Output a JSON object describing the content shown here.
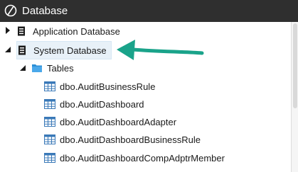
{
  "window": {
    "title": "Database",
    "logo_icon": "onestream-logo-icon"
  },
  "tree": {
    "databases": [
      {
        "label": "Application Database",
        "expanded": false,
        "icon": "database-icon"
      },
      {
        "label": "System Database",
        "expanded": true,
        "selected": true,
        "icon": "database-icon"
      }
    ],
    "folder": {
      "label": "Tables",
      "icon": "folder-icon",
      "expanded": true
    },
    "tables": [
      "dbo.AuditBusinessRule",
      "dbo.AuditDashboard",
      "dbo.AuditDashboardAdapter",
      "dbo.AuditDashboardBusinessRule",
      "dbo.AuditDashboardCompAdptrMember"
    ]
  },
  "annotation": {
    "icon": "pointer-arrow-icon",
    "color": "#1aa38a"
  },
  "colors": {
    "titlebar": "#2f2f2f",
    "selection": "#e8f1f8",
    "folder": "#2c8fd6",
    "table_icon": "#3a79b8"
  }
}
